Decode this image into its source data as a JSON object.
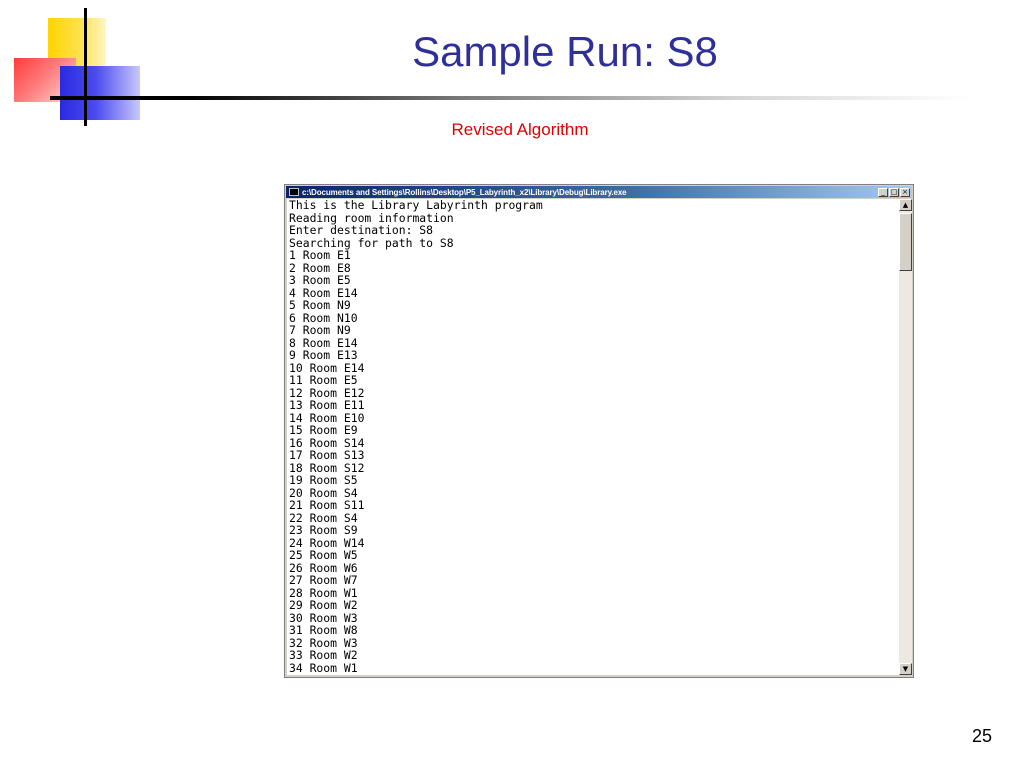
{
  "slide": {
    "title": "Sample Run: S8",
    "subtitle": "Revised Algorithm",
    "page_number": "25"
  },
  "console": {
    "title": "c:\\Documents and Settings\\Rollins\\Desktop\\P5_Labyrinth_x2\\Library\\Debug\\Library.exe",
    "buttons": {
      "minimize": "_",
      "maximize": "□",
      "close": "×"
    },
    "lines": [
      "This is the Library Labyrinth program",
      "Reading room information",
      "Enter destination: S8",
      "Searching for path to S8",
      "1 Room E1",
      "2 Room E8",
      "3 Room E5",
      "4 Room E14",
      "5 Room N9",
      "6 Room N10",
      "7 Room N9",
      "8 Room E14",
      "9 Room E13",
      "10 Room E14",
      "11 Room E5",
      "12 Room E12",
      "13 Room E11",
      "14 Room E10",
      "15 Room E9",
      "16 Room S14",
      "17 Room S13",
      "18 Room S12",
      "19 Room S5",
      "20 Room S4",
      "21 Room S11",
      "22 Room S4",
      "23 Room S9",
      "24 Room W14",
      "25 Room W5",
      "26 Room W6",
      "27 Room W7",
      "28 Room W1",
      "29 Room W2",
      "30 Room W3",
      "31 Room W8",
      "32 Room W3",
      "33 Room W2",
      "34 Room W1"
    ]
  },
  "scrollbar": {
    "up": "▲",
    "down": "▼"
  },
  "icons": {
    "window_icon": "console-icon",
    "logo": "slide-logo-graphic"
  },
  "colors": {
    "title": "#2f2f9a",
    "subtitle": "#e00000",
    "titlebar": "#0a246a"
  }
}
